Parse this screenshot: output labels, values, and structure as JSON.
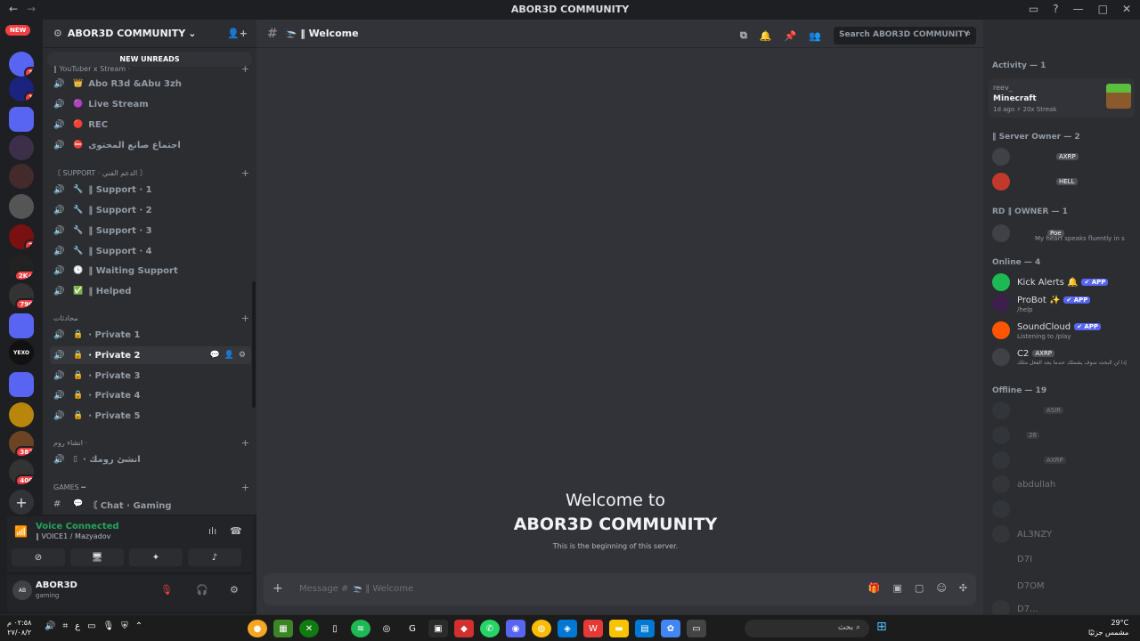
{
  "window": {
    "title": "ABOR3D COMMUNITY",
    "back_icon": "←",
    "forward_icon": "→",
    "controls": [
      "▭",
      "?",
      "—",
      "□",
      "✕"
    ]
  },
  "server_rail": {
    "new_badge": "NEW",
    "badges": [
      "3",
      "1",
      "2",
      "2K+",
      "790",
      "382",
      "400"
    ],
    "labels": [
      "YEXO"
    ]
  },
  "guild": {
    "name": "ABOR3D COMMUNITY",
    "chevron": "⌄",
    "new_unreads": "NEW UNREADS"
  },
  "categories": [
    {
      "label": "‖ YouTuber x Stream ·"
    },
    {
      "label": "〘 SUPPORT · الدعم الفني 〙"
    },
    {
      "label": "محادثات"
    },
    {
      "label": "انشاء روم ·"
    },
    {
      "label": "GAMES ━"
    }
  ],
  "channels": [
    {
      "emoji": "👑",
      "label": "Abo R3d &Abu 3zh"
    },
    {
      "emoji": "🟣",
      "label": "Live Stream"
    },
    {
      "emoji": "🔴",
      "label": "REC"
    },
    {
      "emoji": "⛔",
      "label": "اجتماع صانع المحتوى"
    },
    {
      "emoji": "🔧",
      "label": "‖ Support · 1"
    },
    {
      "emoji": "🔧",
      "label": "‖ Support · 2"
    },
    {
      "emoji": "🔧",
      "label": "‖ Support · 3"
    },
    {
      "emoji": "🔧",
      "label": "‖ Support · 4"
    },
    {
      "emoji": "🕓",
      "label": "‖ Waiting Support"
    },
    {
      "emoji": "✅",
      "label": "‖ Helped"
    },
    {
      "emoji": "🔒",
      "label": "· Private 1"
    },
    {
      "emoji": "🔒",
      "label": "· Private 2"
    },
    {
      "emoji": "🔒",
      "label": "· Private 3"
    },
    {
      "emoji": "🔒",
      "label": "· Private 4"
    },
    {
      "emoji": "🔒",
      "label": "· Private 5"
    },
    {
      "emoji": "▯",
      "label": "· انشئ رومك"
    },
    {
      "emoji": "💬",
      "label": "〘 Chat · Gaming"
    }
  ],
  "voice": {
    "status": "Voice Connected",
    "channel": "‖ VOICE1 / Mazyadov"
  },
  "user": {
    "name": "ABOR3D",
    "status": "gaming"
  },
  "header": {
    "channel": "🛬 ‖ Welcome",
    "search_placeholder": "Search ABOR3D COMMUNITY"
  },
  "welcome": {
    "line1": "Welcome to",
    "line2": "ABOR3D COMMUNITY",
    "line3": "This is the beginning of this server."
  },
  "composer": {
    "placeholder": "Message # 🛬 ‖ Welcome"
  },
  "members": {
    "activity_header": "Activity — 1",
    "activity": {
      "user": "reev_",
      "game": "Minecraft",
      "detail": "1d ago  ⚡ 20x Streak"
    },
    "owner_header": "‖ Server Owner — 2",
    "owners": [
      {
        "name": "",
        "tag": "AXRP"
      },
      {
        "name": "",
        "tag": "HELL"
      }
    ],
    "rd_header": "RD ‖ OWNER — 1",
    "rd_owner": {
      "tag": "Poe",
      "sub": "My heart speaks fluently in s"
    },
    "online_header": "Online — 4",
    "online": [
      {
        "name": "Kick Alerts 🔔",
        "badge": "✔ APP",
        "sub": ""
      },
      {
        "name": "ProBot ✨",
        "badge": "✔ APP",
        "sub": "/help"
      },
      {
        "name": "SoundCloud",
        "badge": "✔ APP",
        "sub": "Listening to /play"
      },
      {
        "name": "C2",
        "badge": "AXRP",
        "sub": "إذا لن البحث سوف يشملك عندما يجد الفعل مثلك"
      }
    ],
    "offline_header": "Offline — 19",
    "offline": [
      {
        "name": "ASIR"
      },
      {
        "name": "26"
      },
      {
        "name": "AXRP"
      },
      {
        "name": "abdullah"
      },
      {
        "name": ""
      },
      {
        "name": "AL3NZY"
      },
      {
        "name": "D7I"
      },
      {
        "name": "D7OM"
      },
      {
        "name": "D7..."
      }
    ]
  },
  "taskbar": {
    "time": "٠٢:٥٨ م",
    "date": "٢٧/٠٨/٢",
    "search": "بحث",
    "temp": "29°C",
    "weather": "مشمس جزئيًا"
  }
}
